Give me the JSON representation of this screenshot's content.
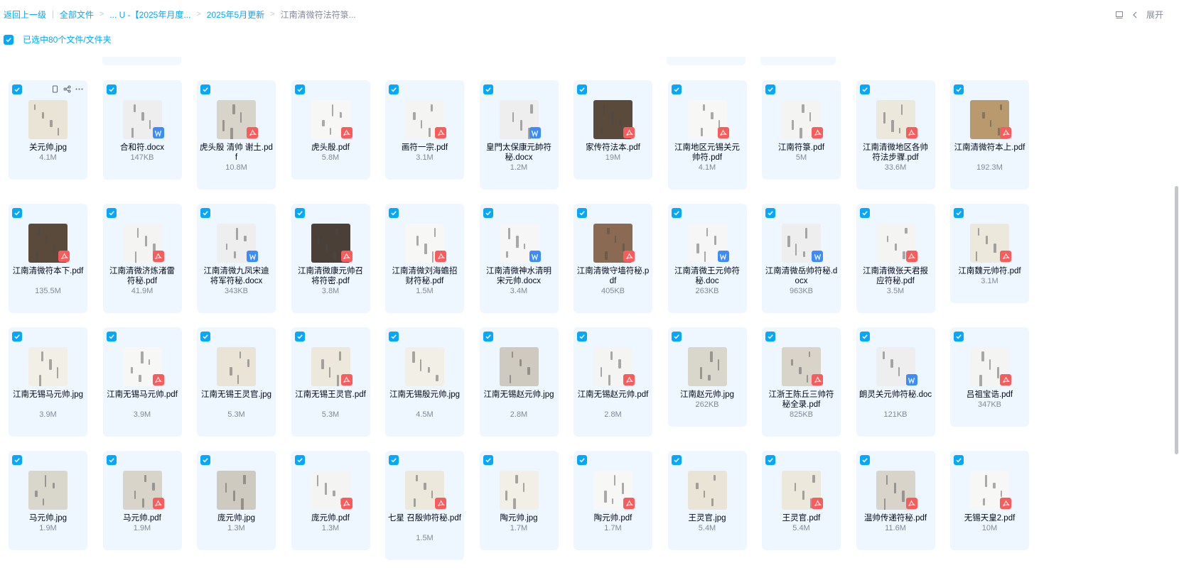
{
  "breadcrumb": {
    "back": "返回上一级",
    "items": [
      "全部文件",
      "... U -【2025年月度...",
      "2025年5月更新",
      "江南清微符法符箓..."
    ]
  },
  "toolbar": {
    "expand_label": "展开"
  },
  "selection": {
    "label": "已选中80个文件/文件夹",
    "checked": true
  },
  "colors": {
    "accent": "#06a7ff",
    "card_bg": "#eef7ff",
    "pdf_badge": "#fa5b5b",
    "doc_badge": "#3c8cff"
  },
  "files": [
    {
      "name": "关元帅.jpg",
      "size": "4.1M",
      "type": "jpg",
      "icon": "image-thumbnail"
    },
    {
      "name": "合和符.docx",
      "size": "147KB",
      "type": "doc",
      "icon": "word-icon"
    },
    {
      "name": "虎头殷 清帅 谢土.pdf",
      "size": "10.8M",
      "type": "pdf",
      "icon": "pdf-icon"
    },
    {
      "name": "虎头殷.pdf",
      "size": "5.8M",
      "type": "pdf",
      "icon": "pdf-icon"
    },
    {
      "name": "画符一宗.pdf",
      "size": "3.1M",
      "type": "pdf",
      "icon": "pdf-icon"
    },
    {
      "name": "皇門太保康元帥符秘.docx",
      "size": "1.2M",
      "type": "doc",
      "icon": "word-icon"
    },
    {
      "name": "家传符法本.pdf",
      "size": "19M",
      "type": "pdf",
      "icon": "pdf-icon"
    },
    {
      "name": "江南地区元锡关元帅符.pdf",
      "size": "4.1M",
      "type": "pdf",
      "icon": "pdf-icon"
    },
    {
      "name": "江南符箓.pdf",
      "size": "5M",
      "type": "pdf",
      "icon": "pdf-icon"
    },
    {
      "name": "江南清微地区各帅符法步骤.pdf",
      "size": "33.6M",
      "type": "pdf",
      "icon": "pdf-icon"
    },
    {
      "name": "江南清微符本上.pdf",
      "size": "192.3M",
      "type": "pdf",
      "icon": "pdf-icon"
    },
    {
      "name": "江南清微符本下.pdf",
      "size": "135.5M",
      "type": "pdf",
      "icon": "pdf-icon"
    },
    {
      "name": "江南清微济炼渚雷符秘.pdf",
      "size": "41.9M",
      "type": "pdf",
      "icon": "pdf-icon"
    },
    {
      "name": "江南清微九凤宋迪将军符秘.docx",
      "size": "343KB",
      "type": "doc",
      "icon": "word-icon"
    },
    {
      "name": "江南清微康元帅召将符密.pdf",
      "size": "3.8M",
      "type": "pdf",
      "icon": "pdf-icon"
    },
    {
      "name": "江南清微刘海蟾招财符秘.pdf",
      "size": "1.5M",
      "type": "pdf",
      "icon": "pdf-icon"
    },
    {
      "name": "江南清微神水清明宋元帅.docx",
      "size": "3.4M",
      "type": "doc",
      "icon": "word-icon"
    },
    {
      "name": "江南清微守墙符秘.pdf",
      "size": "405KB",
      "type": "pdf",
      "icon": "pdf-icon"
    },
    {
      "name": "江南清微王元帅符秘.doc",
      "size": "263KB",
      "type": "doc",
      "icon": "word-icon"
    },
    {
      "name": "江南清微岳帅符秘.docx",
      "size": "963KB",
      "type": "doc",
      "icon": "word-icon"
    },
    {
      "name": "江南清微张天君报应符秘.pdf",
      "size": "3.5M",
      "type": "pdf",
      "icon": "pdf-icon"
    },
    {
      "name": "江南魏元帅符.pdf",
      "size": "3.1M",
      "type": "pdf",
      "icon": "pdf-icon"
    },
    {
      "name": "江南无锡马元帅.jpg",
      "size": "3.9M",
      "type": "jpg",
      "icon": "image-thumbnail"
    },
    {
      "name": "江南无锡马元帅.pdf",
      "size": "3.9M",
      "type": "pdf",
      "icon": "pdf-icon"
    },
    {
      "name": "江南无锡王灵官.jpg",
      "size": "5.3M",
      "type": "jpg",
      "icon": "image-thumbnail"
    },
    {
      "name": "江南无锡王灵官.pdf",
      "size": "5.3M",
      "type": "pdf",
      "icon": "pdf-icon"
    },
    {
      "name": "江南无锡殷元帅.jpg",
      "size": "4.5M",
      "type": "jpg",
      "icon": "image-thumbnail"
    },
    {
      "name": "江南无锡赵元帅.jpg",
      "size": "2.8M",
      "type": "jpg",
      "icon": "image-thumbnail"
    },
    {
      "name": "江南无锡赵元帅.pdf",
      "size": "2.8M",
      "type": "pdf",
      "icon": "pdf-icon"
    },
    {
      "name": "江南赵元帅.jpg",
      "size": "262KB",
      "type": "jpg",
      "icon": "image-thumbnail"
    },
    {
      "name": "江浙王陈丘三帅符秘全录.pdf",
      "size": "825KB",
      "type": "pdf",
      "icon": "pdf-icon"
    },
    {
      "name": "朗灵关元帅符秘.doc",
      "size": "121KB",
      "type": "doc",
      "icon": "word-icon"
    },
    {
      "name": "吕祖宝诰.pdf",
      "size": "347KB",
      "type": "pdf",
      "icon": "pdf-icon"
    },
    {
      "name": "马元帅.jpg",
      "size": "1.9M",
      "type": "jpg",
      "icon": "image-thumbnail"
    },
    {
      "name": "马元帅.pdf",
      "size": "1.9M",
      "type": "pdf",
      "icon": "pdf-icon"
    },
    {
      "name": "庞元帅.jpg",
      "size": "1.3M",
      "type": "jpg",
      "icon": "image-thumbnail"
    },
    {
      "name": "庞元帅.pdf",
      "size": "1.3M",
      "type": "pdf",
      "icon": "pdf-icon"
    },
    {
      "name": "七星 召殷帅符秘.pdf",
      "size": "1.5M",
      "type": "pdf",
      "icon": "pdf-icon"
    },
    {
      "name": "陶元帅.jpg",
      "size": "1.7M",
      "type": "jpg",
      "icon": "image-thumbnail"
    },
    {
      "name": "陶元帅.pdf",
      "size": "1.7M",
      "type": "pdf",
      "icon": "pdf-icon"
    },
    {
      "name": "王灵官.jpg",
      "size": "5.4M",
      "type": "jpg",
      "icon": "image-thumbnail"
    },
    {
      "name": "王灵官.pdf",
      "size": "5.4M",
      "type": "pdf",
      "icon": "pdf-icon"
    },
    {
      "name": "温帅传递符秘.pdf",
      "size": "11.6M",
      "type": "pdf",
      "icon": "pdf-icon"
    },
    {
      "name": "无锡天皇2.pdf",
      "size": "10M",
      "type": "pdf",
      "icon": "pdf-icon"
    }
  ]
}
